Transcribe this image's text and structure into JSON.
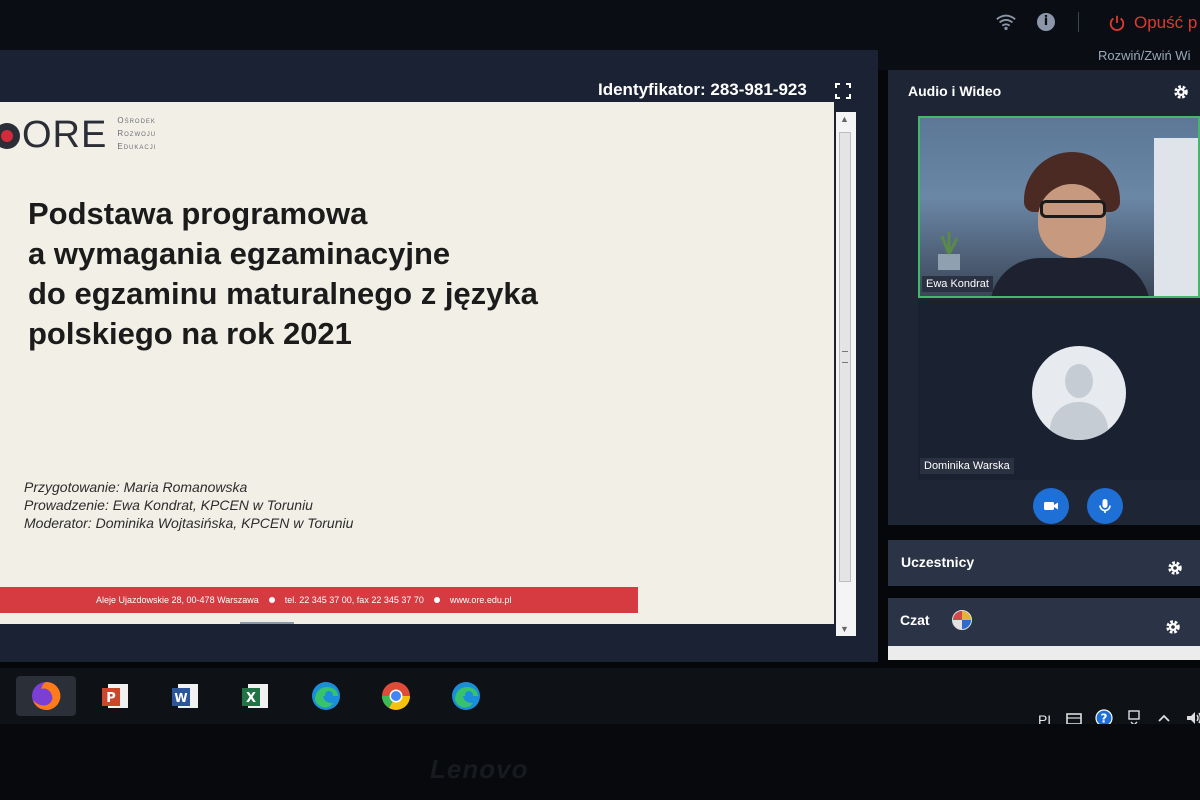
{
  "topbar": {
    "leave_label": "Opuść p",
    "expand_label": "Rozwiń/Zwiń Wi",
    "icons": [
      "wifi-icon",
      "info-icon",
      "power-icon"
    ],
    "leave_color": "#e03a2f"
  },
  "presentation": {
    "meeting_id": "Identyfikator: 283-981-923",
    "slide": {
      "logo_text": "ORE",
      "logo_subtitle": [
        "Ośrodek",
        "Rozwoju",
        "Edukacji"
      ],
      "title_lines": [
        "Podstawa programowa",
        "a wymagania egzaminacyjne",
        "do egzaminu maturalnego z języka",
        "polskiego na rok 2021"
      ],
      "credits": [
        "Przygotowanie: Maria Romanowska",
        "Prowadzenie: Ewa Kondrat, KPCEN w Toruniu",
        "Moderator: Dominika Wojtasińska, KPCEN w Toruniu"
      ],
      "footer": {
        "address": "Aleje Ujazdowskie 28, 00-478 Warszawa",
        "phone": "tel. 22 345 37 00, fax 22 345 37 70",
        "website": "www.ore.edu.pl"
      },
      "accent_color": "#d63b41"
    }
  },
  "audio_video": {
    "title": "Audio i Wideo",
    "participants": [
      {
        "name": "Ewa Kondrat",
        "video": "on"
      },
      {
        "name": "Dominika Warska",
        "video": "off"
      }
    ],
    "active_border_color": "#44b86a",
    "button_color": "#1e6fd6",
    "buttons": [
      "camera-icon",
      "microphone-icon"
    ]
  },
  "participants_panel": {
    "title": "Uczestnicy"
  },
  "chat_panel": {
    "title": "Czat"
  },
  "taskbar": {
    "apps": [
      "firefox",
      "powerpoint",
      "word",
      "excel",
      "edge",
      "chrome",
      "edge"
    ],
    "tray_lang": "PL",
    "tray_icons": [
      "network-icon",
      "help-icon",
      "notification-icon",
      "chevron-up-icon",
      "speaker-icon"
    ]
  },
  "bezel": {
    "brand": "Lenovo"
  }
}
